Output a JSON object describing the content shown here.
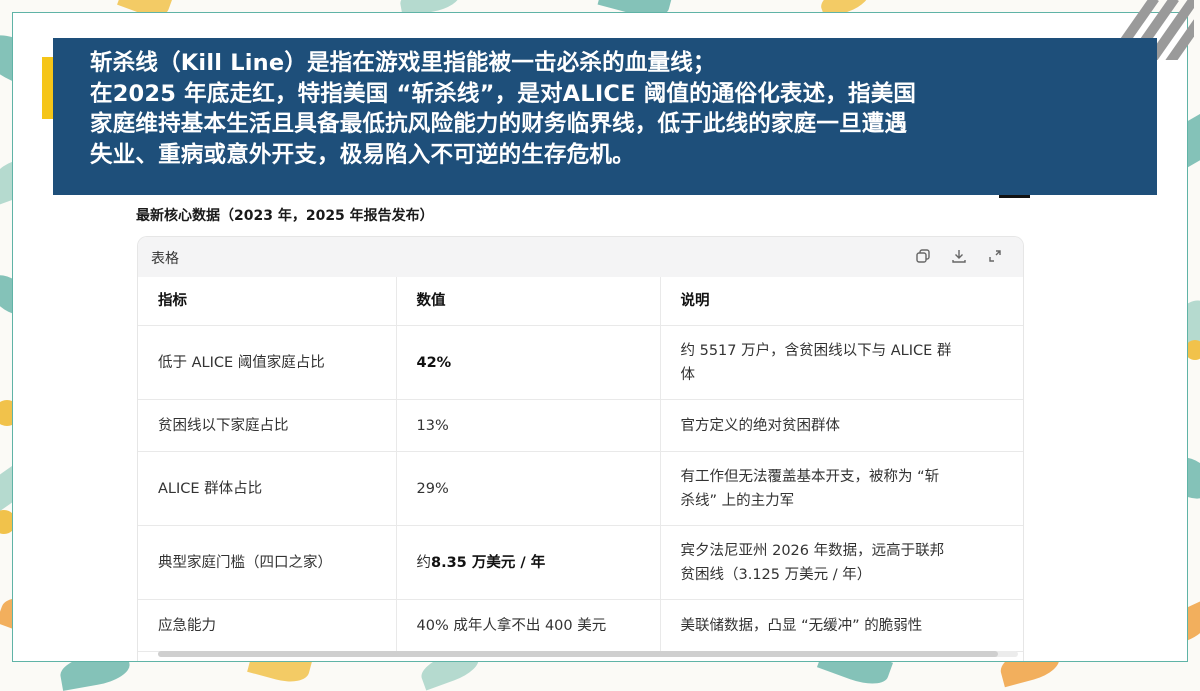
{
  "banner": {
    "line1": "斩杀线（Kill Line）是指在游戏里指能被一击必杀的血量线；",
    "line2": "在2025 年底走红，特指美国 “斩杀线”，是对ALICE 阈值的通俗化表述，指美国",
    "line3": "家庭维持基本生活且具备最低抗风险能力的财务临界线，低于此线的家庭一旦遭遇",
    "line4": "失业、重病或意外开支，极易陷入不可逆的生存危机。"
  },
  "section_title": "最新核心数据（2023 年，2025 年报告发布）",
  "table": {
    "label": "表格",
    "tools": [
      "copy-icon",
      "download-icon",
      "expand-icon"
    ],
    "headers": [
      "指标",
      "数值",
      "说明"
    ],
    "rows": [
      {
        "indicator": "低于 ALICE 阈值家庭占比",
        "value": "42%",
        "value_bold": true,
        "note_line1": "约 5517 万户，含贫困线以下与 ALICE 群",
        "note_line2": "体"
      },
      {
        "indicator": "贫困线以下家庭占比",
        "value": "13%",
        "value_bold": false,
        "note_line1": "官方定义的绝对贫困群体",
        "note_line2": ""
      },
      {
        "indicator": "ALICE 群体占比",
        "value": "29%",
        "value_bold": false,
        "note_line1": "有工作但无法覆盖基本开支，被称为 “斩",
        "note_line2": "杀线” 上的主力军"
      },
      {
        "indicator": "典型家庭门槛（四口之家）",
        "value_prefix": "约",
        "value": "8.35 万美元 / 年",
        "value_bold": true,
        "note_line1": "宾夕法尼亚州 2026 年数据，远高于联邦",
        "note_line2": "贫困线（3.125 万美元 / 年）"
      },
      {
        "indicator": "应急能力",
        "value": "40% 成年人拿不出 400 美元",
        "value_bold": false,
        "note_line1": "美联储数据，凸显 “无缓冲” 的脆弱性",
        "note_line2": ""
      }
    ]
  },
  "colors": {
    "banner_bg": "#1e4f7a",
    "accent_yellow": "#f5c518",
    "frame_teal": "#5fb3a6"
  }
}
